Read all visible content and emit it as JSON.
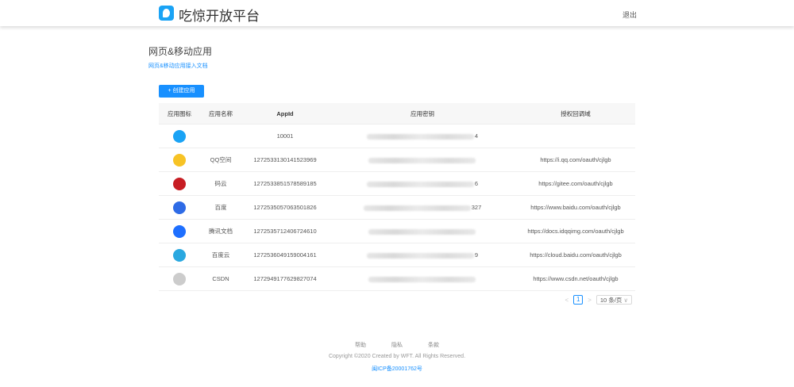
{
  "header": {
    "brand": "吃惊开放平台",
    "logout": "退出"
  },
  "page": {
    "title": "网页&移动应用",
    "doc_link": "网页&移动应用接入文档",
    "create_button": "+ 创建应用"
  },
  "table": {
    "headers": [
      "应用图标",
      "应用名称",
      "AppId",
      "应用密钥",
      "授权回调域"
    ],
    "rows": [
      {
        "name": "",
        "appid": "10001",
        "secret_suffix": "4",
        "domain": "",
        "icon": "chijing-icon",
        "color": "#1aa3f5"
      },
      {
        "name": "QQ空间",
        "appid": "1272533130141523969",
        "secret_suffix": "",
        "domain": "https://i.qq.com/oauth/cjlgb",
        "icon": "qzone-icon",
        "color": "#f7c325"
      },
      {
        "name": "码云",
        "appid": "1272533851578589185",
        "secret_suffix": "6",
        "domain": "https://gitee.com/oauth/cjlgb",
        "icon": "gitee-icon",
        "color": "#c71d23"
      },
      {
        "name": "百度",
        "appid": "1272535057063501826",
        "secret_suffix": "327",
        "domain": "https://www.baidu.com/oauth/cjlgb",
        "icon": "baidu-icon",
        "color": "#2e6be6"
      },
      {
        "name": "腾讯文档",
        "appid": "1272535712406724610",
        "secret_suffix": "",
        "domain": "https://docs.idqqimg.com/oauth/cjlgb",
        "icon": "tencent-docs-icon",
        "color": "#1e6fff"
      },
      {
        "name": "百度云",
        "appid": "1272536049159004161",
        "secret_suffix": "9",
        "domain": "https://cloud.baidu.com/oauth/cjlgb",
        "icon": "baidu-cloud-icon",
        "color": "#2aa8e0"
      },
      {
        "name": "CSDN",
        "appid": "1272949177629827074",
        "secret_suffix": "",
        "domain": "https://www.csdn.net/oauth/cjlgb",
        "icon": "csdn-icon",
        "color": "#cccccc"
      }
    ]
  },
  "pagination": {
    "prev": "<",
    "current": "1",
    "next": ">",
    "page_size": "10 条/页"
  },
  "footer": {
    "links": [
      "帮助",
      "隐私",
      "条款"
    ],
    "copyright": "Copyright ©2020 Created by WFT. All Rights Reserved.",
    "icp": "闽ICP备20001762号"
  }
}
